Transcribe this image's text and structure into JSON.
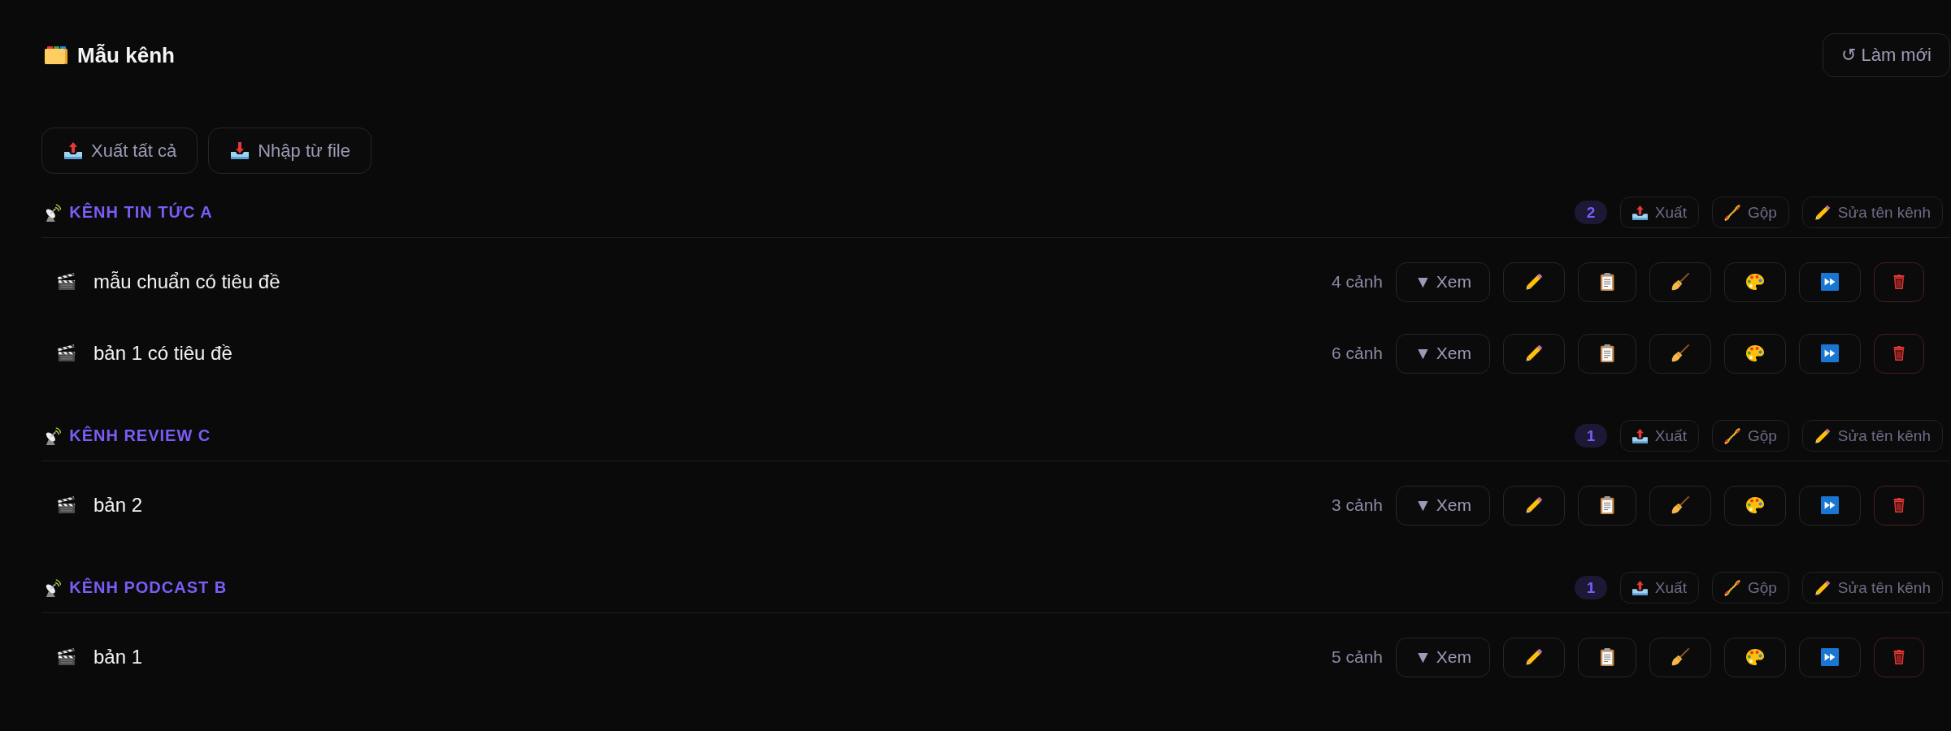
{
  "header": {
    "title": "Mẫu kênh",
    "refresh_button": "↺ Làm mới"
  },
  "toolbar": [
    {
      "kind": "export",
      "label": "Xuất tất cả"
    },
    {
      "kind": "import",
      "label": "Nhập từ file"
    }
  ],
  "channels": [
    {
      "name": "KÊNH TIN TỨC A",
      "count": "2",
      "actions": [
        {
          "kind": "export",
          "label": "Xuất"
        },
        {
          "kind": "merge",
          "label": "Gộp"
        },
        {
          "kind": "rename",
          "label": "Sửa tên kênh"
        }
      ],
      "templates": [
        {
          "name": "mẫu chuẩn có tiêu đề",
          "scenes": "4 cảnh",
          "view_button": "▼ Xem"
        },
        {
          "name": "bản 1 có tiêu đề",
          "scenes": "6 cảnh",
          "view_button": "▼ Xem"
        }
      ]
    },
    {
      "name": "KÊNH REVIEW C",
      "count": "1",
      "actions": [
        {
          "kind": "export",
          "label": "Xuất"
        },
        {
          "kind": "merge",
          "label": "Gộp"
        },
        {
          "kind": "rename",
          "label": "Sửa tên kênh"
        }
      ],
      "templates": [
        {
          "name": "bản 2",
          "scenes": "3 cảnh",
          "view_button": "▼ Xem"
        }
      ]
    },
    {
      "name": "KÊNH PODCAST B",
      "count": "1",
      "actions": [
        {
          "kind": "export",
          "label": "Xuất"
        },
        {
          "kind": "merge",
          "label": "Gộp"
        },
        {
          "kind": "rename",
          "label": "Sửa tên kênh"
        }
      ],
      "templates": [
        {
          "name": "bản 1",
          "scenes": "5 cảnh",
          "view_button": "▼ Xem"
        }
      ]
    }
  ]
}
